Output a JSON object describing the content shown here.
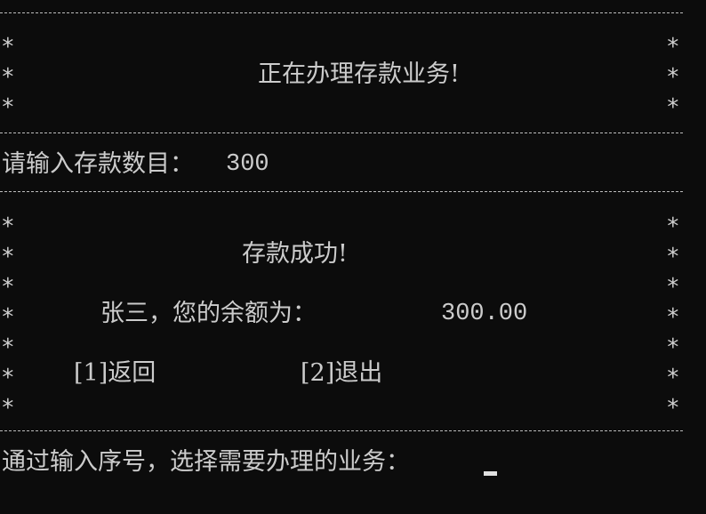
{
  "banner": {
    "title": "正在办理存款业务!"
  },
  "prompt": {
    "label": "请输入存款数目：",
    "value": "300"
  },
  "result": {
    "message": "存款成功!",
    "balance_label": "张三，您的余额为：",
    "balance_value": "300.00"
  },
  "menu": {
    "back": "[1]返回",
    "exit": "[2]退出"
  },
  "footer": {
    "prompt": "通过输入序号，选择需要办理的业务："
  },
  "frame": {
    "border_char": "*"
  }
}
